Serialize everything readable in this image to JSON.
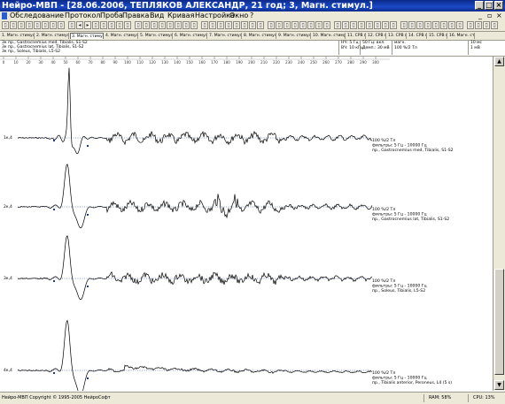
{
  "window": {
    "title": "Нейро-МВП - [28.06.2006, ТЕПЛЯКОВ АЛЕКСАНДР, 21 год; 3, Магн. стимул.]",
    "controls": {
      "minimize": "_",
      "maximize": "□",
      "close": "×"
    }
  },
  "menu": {
    "items": [
      "Обследование",
      "Протокол",
      "Проба",
      "Правка",
      "Вид",
      "Кривая",
      "Настройка",
      "Окно",
      "?"
    ],
    "doc_controls": {
      "minimize": "_",
      "restore": "▫",
      "close": "×"
    }
  },
  "tabs": [
    "1. Магн. стимул.",
    "2. Магн. стимул.",
    "3. Магн. стимул.",
    "4. Магн. стимул.",
    "5. Магн. стимул.",
    "6. Магн. стимул.",
    "7. Магн. стимул.",
    "8. Магн. стимул.",
    "9. Магн. стимул.",
    "10. Магн. стимул.",
    "11. СРВ м",
    "12. СРВ м",
    "13. СРВ м",
    "14. СРВ м",
    "15. СРВ м",
    "16. Магн. стимул."
  ],
  "info": {
    "left_lines": [
      "3к пр., Gastrocnemius med, Tibialis, S1-S2",
      "3к пр., Gastrocnemius lat, Tibialis, S1-S2",
      "3к пр., Soleus, Tibialis, L5-S2"
    ],
    "filters": [
      "НЧ: 5 Гц",
      "ВЧ: 10 кГц"
    ],
    "amp": [
      "50 Гц: вкл.",
      "Демп.: 30 мВ"
    ],
    "stim": [
      "магн.",
      "100 %/2 Тл"
    ],
    "sweep": [
      "10 мс",
      "1 мВ"
    ]
  },
  "channels": [
    {
      "id": "1к,4",
      "intensity": "100 %/2 Тл",
      "filters": "фильтры: 5 Гц - 10000 Гц",
      "site": "пр., Gastrocnemius med, Tibialis, S1-S2"
    },
    {
      "id": "2к,4",
      "intensity": "100 %/2 Тл",
      "filters": "фильтры: 5 Гц - 10000 Гц",
      "site": "пр., Gastrocnemius lat, Tibialis, S1-S2"
    },
    {
      "id": "3к,4",
      "intensity": "100 %/2 Тл",
      "filters": "фильтры: 5 Гц - 10000 Гц",
      "site": "пр., Soleus, Tibialis, L5-S2"
    },
    {
      "id": "4к,4",
      "intensity": "100 %/2 Тл",
      "filters": "фильтры: 5 Гц - 10000 Гц",
      "site": "пр., Tibialis anterior, Peroneus, L4 (5 s)"
    }
  ],
  "time_axis": [
    "0",
    "10",
    "20",
    "30",
    "40",
    "50",
    "60",
    "70",
    "80",
    "90",
    "100",
    "110",
    "120",
    "130",
    "140",
    "150",
    "160",
    "170",
    "180",
    "190",
    "200",
    "210",
    "220",
    "230",
    "240",
    "250",
    "260",
    "270",
    "280",
    "290",
    "300"
  ],
  "status": {
    "copyright": "Нейро-МВП Copyright © 1995-2005 НейроСофт",
    "ram": "RAM: 58%",
    "cpu": "CPU: 13%"
  }
}
